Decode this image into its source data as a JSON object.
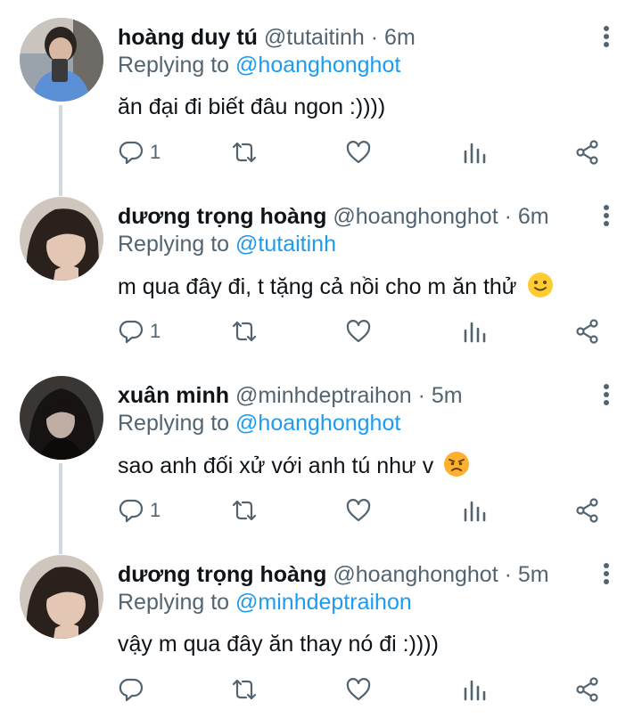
{
  "tweets": [
    {
      "name": "hoàng duy tú",
      "handle": "@tutaitinh",
      "dot": " · ",
      "time": "6m",
      "replying_label": "Replying to ",
      "replying_to": "@hoanghonghot",
      "text": "ăn đại đi biết đâu ngon :))))",
      "reply_count": "1"
    },
    {
      "name": "dương trọng hoàng",
      "handle": "@hoanghonghot",
      "dot": " · ",
      "time": "6m",
      "replying_label": "Replying to ",
      "replying_to": "@tutaitinh",
      "text": "m qua đây đi, t tặng cả nồi cho m ăn thử",
      "emoji": "slightly-smiling-face",
      "reply_count": "1"
    },
    {
      "name": "xuân minh",
      "handle": "@minhdeptraihon",
      "dot": " · ",
      "time": "5m",
      "replying_label": "Replying to ",
      "replying_to": "@hoanghonghot",
      "text": "sao anh đối xử với anh tú như v",
      "emoji": "angry-face",
      "reply_count": "1"
    },
    {
      "name": "dương trọng hoàng",
      "handle": "@hoanghonghot",
      "dot": " · ",
      "time": "5m",
      "replying_label": "Replying to ",
      "replying_to": "@minhdeptraihon",
      "text": "vậy m qua đây ăn thay nó đi :))))",
      "reply_count": ""
    }
  ],
  "colors": {
    "text": "#0f1419",
    "secondary": "#536471",
    "link": "#1d9bf0",
    "thread_line": "#cfd9de"
  },
  "icons": [
    "more-vertical-icon",
    "reply-icon",
    "retweet-icon",
    "like-icon",
    "analytics-icon",
    "share-icon"
  ]
}
